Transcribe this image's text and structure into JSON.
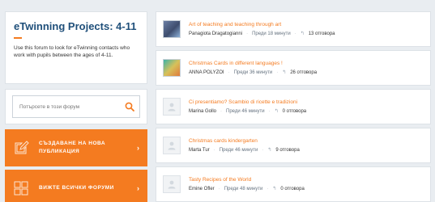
{
  "sidebar": {
    "title": "eTwinning Projects: 4-11",
    "description": "Use this forum to look for eTwinning contacts who work with pupils between the ages of 4-11.",
    "search": {
      "placeholder": "Потърсете в този форум"
    },
    "create_button": {
      "label": "СЪЗДАВАНЕ НА НОВА ПУБЛИКАЦИЯ",
      "icon": "create-post-icon"
    },
    "view_button": {
      "label": "ВИЖТЕ ВСИЧКИ ФОРУМИ",
      "icon": "grid-icon"
    }
  },
  "posts": [
    {
      "title": "Art of teaching and teaching through art",
      "author": "Panagiota Dragatogianni",
      "time": "Преди 18 минути",
      "replies": "13 отговора",
      "thumb": "photo"
    },
    {
      "title": "Christmas Cards in different languages !",
      "author": "ANNA POLYZOI",
      "time": "Преди 36 минути",
      "replies": "26 отговора",
      "thumb": "photo"
    },
    {
      "title": "Ci presentiamo? Scambio di ricette e tradizioni",
      "author": "Marina Gollo",
      "time": "Преди 46 минути",
      "replies": "0 отговора",
      "thumb": "placeholder"
    },
    {
      "title": "Christmas cards kindergarten",
      "author": "Marta Tur",
      "time": "Преди 46 минути",
      "replies": "9 отговора",
      "thumb": "placeholder"
    },
    {
      "title": "Tasty Recipes of the World",
      "author": "Emine Ofler",
      "time": "Преди 48 минути",
      "replies": "0 отговора",
      "thumb": "placeholder"
    }
  ],
  "colors": {
    "accent": "#f47b20",
    "title_blue": "#1f4f7a",
    "background": "#e9edf1"
  }
}
